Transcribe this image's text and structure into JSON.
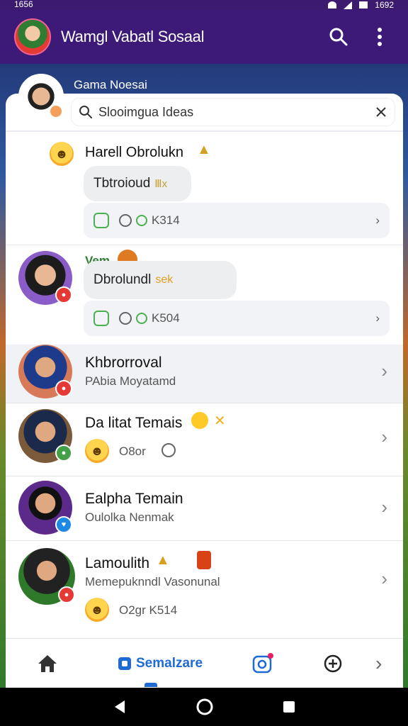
{
  "status_bar": {
    "time": "1656",
    "right_text": "1692"
  },
  "app_bar": {
    "title": "Wamgl Vabatl Sosaal",
    "search_icon": "search-icon",
    "more_icon": "more-vert-icon"
  },
  "hero": {
    "name": "Gama Noesai"
  },
  "search": {
    "value": "Slooimgua Ideas",
    "clear_icon": "close-icon"
  },
  "messages": [
    {
      "sender": "Harell Obrolukn",
      "bubble": "Tbtroioud",
      "bubble_tail": "Ⅲx",
      "reactions": "K314"
    },
    {
      "sender": "Vem",
      "bubble": "Dbrolundl",
      "bubble_tail": "sek",
      "reactions": "K504"
    }
  ],
  "rows": [
    {
      "name": "Khbrorroval",
      "sub": "PAbia Moyatamd",
      "badge_color": "#e53935"
    },
    {
      "name": "Da litat Temais",
      "sub": "O8or",
      "badge_color": "#43a047"
    },
    {
      "name": "Ealpha Temain",
      "sub": "Oulolka Nenmak",
      "badge_color": "#1e88e5"
    },
    {
      "name": "Lamoulith",
      "sub": "Memepuknndl Vasonunal",
      "extra": "O2gr K514",
      "badge_color": "#e53935"
    }
  ],
  "nav": {
    "active_label": "Semalzare",
    "items": [
      "home-icon",
      "semalzare-tab",
      "instagram-icon",
      "add-circle-icon",
      "chevron-right-icon"
    ]
  },
  "colors": {
    "app_bar": "#3d1a78",
    "accent": "#1e6bd6",
    "status_green": "#4caf50"
  }
}
